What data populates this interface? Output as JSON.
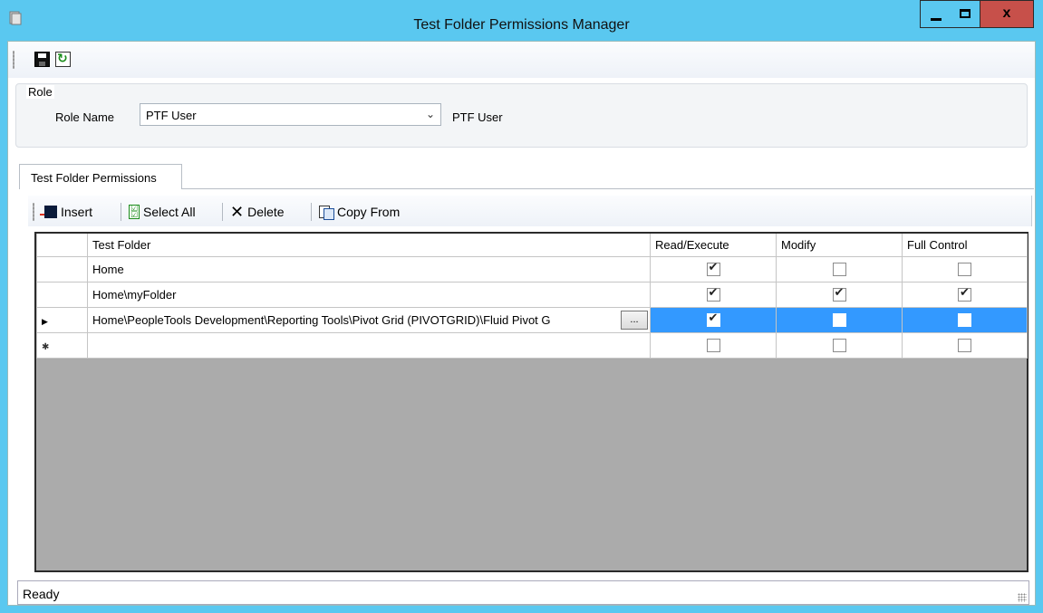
{
  "window": {
    "title": "Test Folder Permissions Manager",
    "app_icon": "form-icon"
  },
  "toolbar": {
    "save_icon": "save-icon",
    "refresh_icon": "refresh-icon"
  },
  "role": {
    "group_label": "Role",
    "name_label": "Role Name",
    "selected_value": "PTF User",
    "description": "PTF User"
  },
  "tabs": [
    {
      "label": "Test Folder Permissions",
      "active": true
    }
  ],
  "grid_toolbar": {
    "insert_label": "Insert",
    "select_all_label": "Select All",
    "delete_label": "Delete",
    "copy_from_label": "Copy From"
  },
  "grid": {
    "columns": [
      "Test Folder",
      "Read/Execute",
      "Modify",
      "Full Control"
    ],
    "rows": [
      {
        "folder": "Home",
        "read_execute": true,
        "modify": false,
        "full_control": false,
        "selected": false
      },
      {
        "folder": "Home\\myFolder",
        "read_execute": true,
        "modify": true,
        "full_control": true,
        "selected": false
      },
      {
        "folder": "Home\\PeopleTools Development\\Reporting Tools\\Pivot Grid (PIVOTGRID)\\Fluid Pivot G",
        "read_execute": true,
        "modify": false,
        "full_control": false,
        "selected": true
      },
      {
        "folder": "",
        "read_execute": false,
        "modify": false,
        "full_control": false,
        "selected": false,
        "new_row": true
      }
    ],
    "ellipsis_label": "..."
  },
  "status": {
    "text": "Ready"
  },
  "colors": {
    "titlebar": "#5ac8f0",
    "close_button": "#c7504a",
    "selection": "#3399ff",
    "grid_empty": "#ababab"
  }
}
